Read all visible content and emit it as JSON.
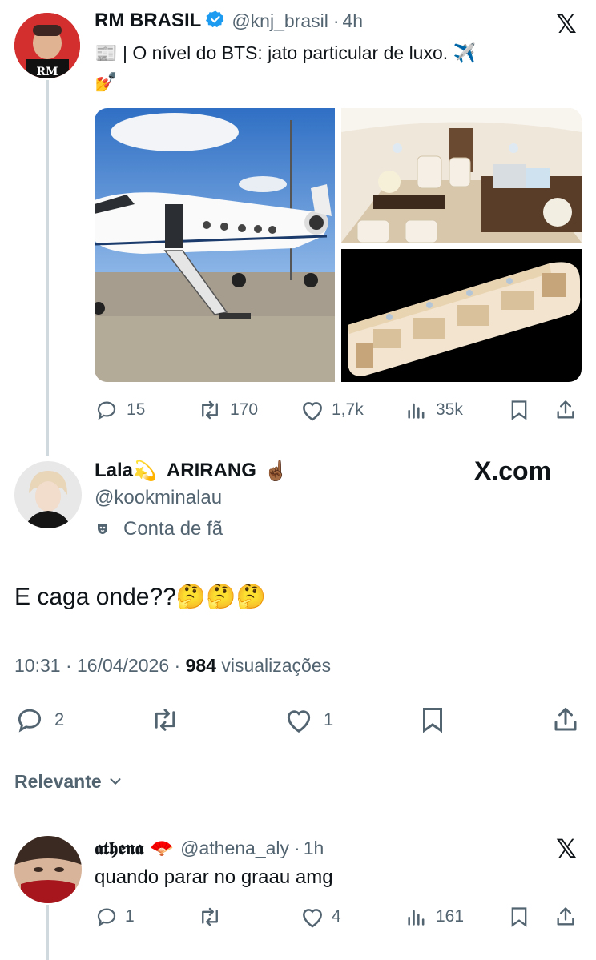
{
  "quoted_tweet": {
    "display_name": "RM BRASIL",
    "handle": "@knj_brasil",
    "separator": "·",
    "time": "4h",
    "text_line1": "| O nível do BTS: jato particular de luxo.",
    "emoji_news": "📰",
    "emoji_plane": "✈️",
    "emoji_nails": "💅",
    "stats": {
      "replies": "15",
      "retweets": "170",
      "likes": "1,7k",
      "views": "35k"
    }
  },
  "main_tweet": {
    "display_name": "Lala",
    "display_name_emoji": "💫",
    "display_name_rest": "ARIRANG",
    "display_name_emoji2": "☝🏾",
    "handle": "@kookminalau",
    "fan_label": "Conta de fã",
    "brand": "X.com",
    "text": "E caga onde??",
    "text_emojis": "🤔🤔🤔",
    "timestamp": "10:31 · 16/04/2026 ·",
    "views_count": "984",
    "views_label": "visualizações",
    "stats": {
      "replies": "2",
      "likes": "1"
    }
  },
  "sort": {
    "label": "Relevante"
  },
  "reply_tweet": {
    "display_name": "𝖆𝖙𝖍𝖊𝖓𝖆",
    "display_name_emoji": "🪭",
    "handle": "@athena_aly",
    "separator": "·",
    "time": "1h",
    "text": "quando parar no graau amg",
    "stats": {
      "replies": "1",
      "likes": "4",
      "views": "161"
    }
  },
  "colors": {
    "text": "#0f1419",
    "muted": "#536471",
    "verified": "#1d9bf0",
    "thread_line": "#cfd9de"
  }
}
